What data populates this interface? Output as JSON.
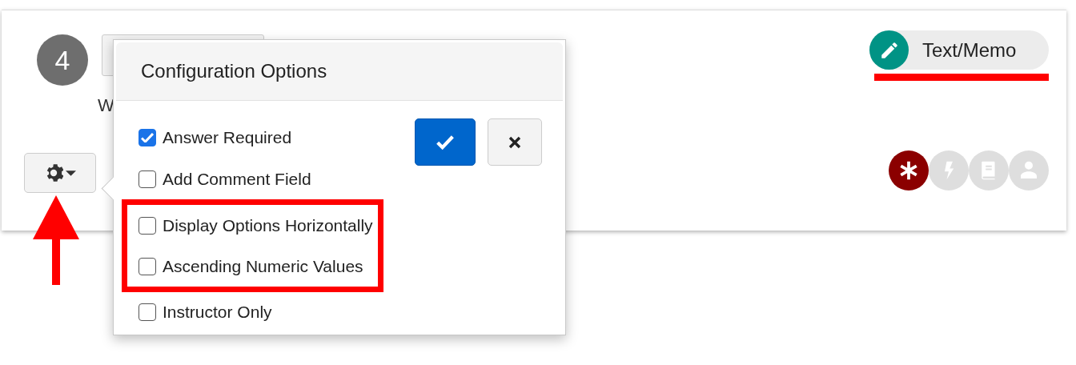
{
  "question": {
    "number": "4",
    "text": "W"
  },
  "type_badge": {
    "label": "Text/Memo",
    "underlined": true
  },
  "indicators": [
    {
      "kind": "required",
      "on": true
    },
    {
      "kind": "action",
      "on": false
    },
    {
      "kind": "reference",
      "on": false
    },
    {
      "kind": "person",
      "on": false
    }
  ],
  "settings_button": {
    "pointed_by_arrow": true
  },
  "popover": {
    "title": "Configuration Options",
    "options": [
      {
        "label": "Answer Required",
        "checked": true,
        "highlighted": false
      },
      {
        "label": "Add Comment Field",
        "checked": false,
        "highlighted": false
      },
      {
        "label": "Display Options Horizontally",
        "checked": false,
        "highlighted": true
      },
      {
        "label": "Ascending Numeric Values",
        "checked": false,
        "highlighted": true
      },
      {
        "label": "Instructor Only",
        "checked": false,
        "highlighted": false
      }
    ]
  }
}
